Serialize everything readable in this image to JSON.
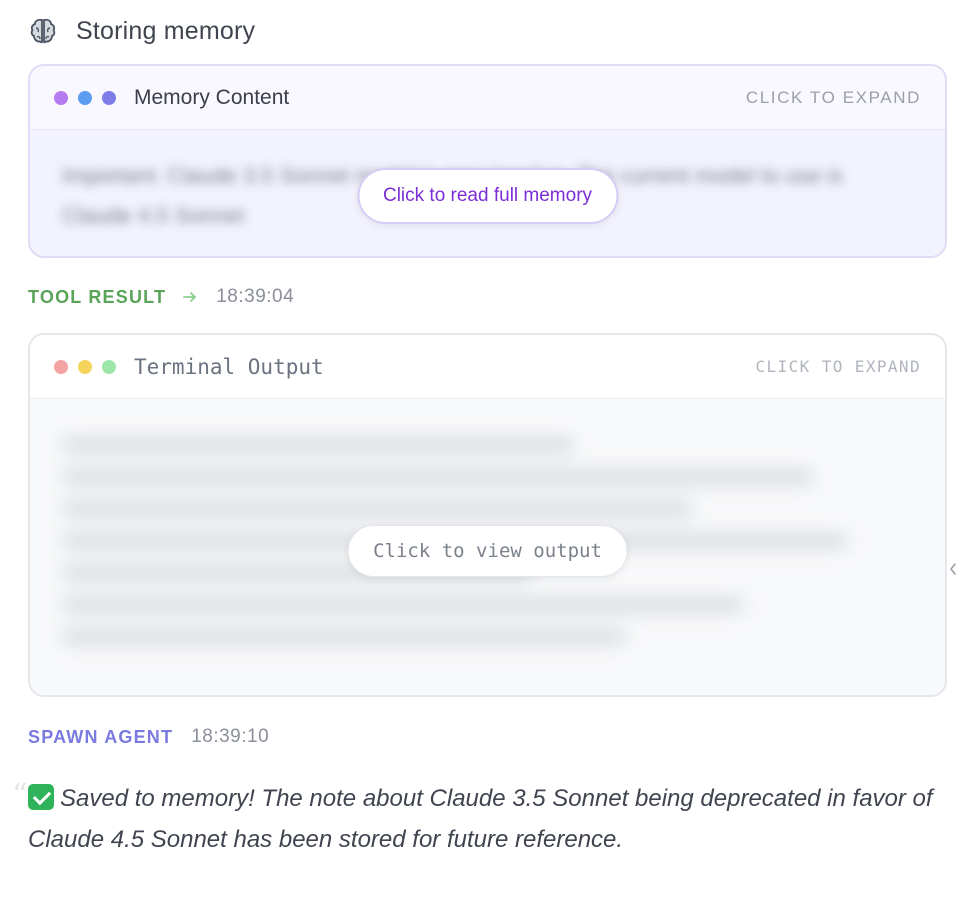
{
  "header": {
    "icon": "brain-icon",
    "title": "Storing memory"
  },
  "memory_card": {
    "title": "Memory Content",
    "expand_hint": "CLICK TO EXPAND",
    "dot_colors": [
      "#b57bf0",
      "#5b9cf0",
      "#7f7ee8"
    ],
    "blurred_text": "Important: Claude 3.5 Sonnet model is now inactive. The current model to use is Claude 4.5 Sonnet",
    "button_label": "Click to read full memory"
  },
  "tool_result": {
    "label": "TOOL RESULT",
    "icon": "arrow-right-icon",
    "timestamp": "18:39:04"
  },
  "terminal_card": {
    "title": "Terminal Output",
    "expand_hint": "CLICK TO EXPAND",
    "dot_colors": [
      "#f3a3a3",
      "#f4d45a",
      "#9ee6a8"
    ],
    "button_label": "Click to view output"
  },
  "spawn_agent": {
    "label": "SPAWN AGENT",
    "timestamp": "18:39:10"
  },
  "message": {
    "icon": "check-icon",
    "text": "Saved to memory! The note about Claude 3.5 Sonnet being deprecated in favor of Claude 4.5 Sonnet has been stored for future reference."
  },
  "colors": {
    "accent_purple": "#7c2ed6",
    "tool_result_green": "#5aa45a",
    "spawn_agent_blue": "#7b7ae0"
  }
}
